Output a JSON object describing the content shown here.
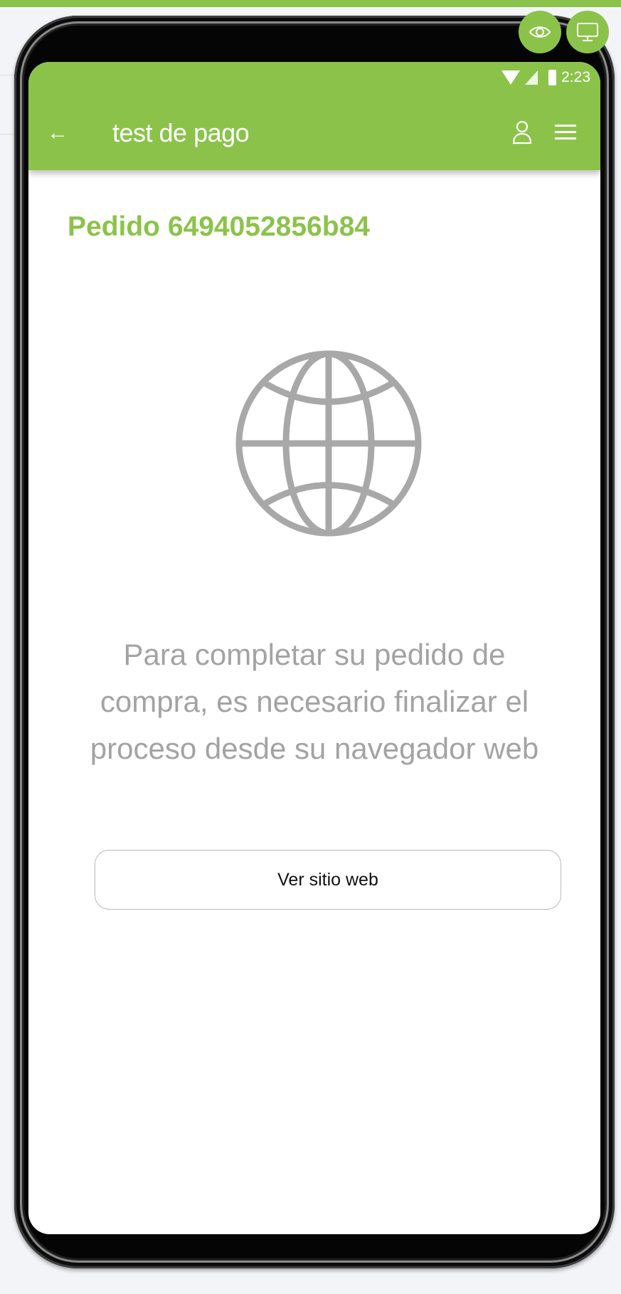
{
  "status_bar": {
    "time": "2:23"
  },
  "header": {
    "title": "test de pago"
  },
  "content": {
    "order_title": "Pedido 6494052856b84",
    "message_lines": [
      "Para completar su pedido de",
      "compra, es necesario finalizar el",
      "proceso desde su navegador web"
    ],
    "button_label": "Ver sitio web"
  },
  "icons": {
    "back": "arrow-left-icon",
    "user": "user-icon",
    "menu": "hamburger-menu-icon",
    "globe": "globe-icon",
    "preview": "eye-icon",
    "desktop": "monitor-icon"
  },
  "colors": {
    "accent": "#8bc34a",
    "message_text": "#a3a3a3",
    "button_border": "#b9b9b9"
  }
}
